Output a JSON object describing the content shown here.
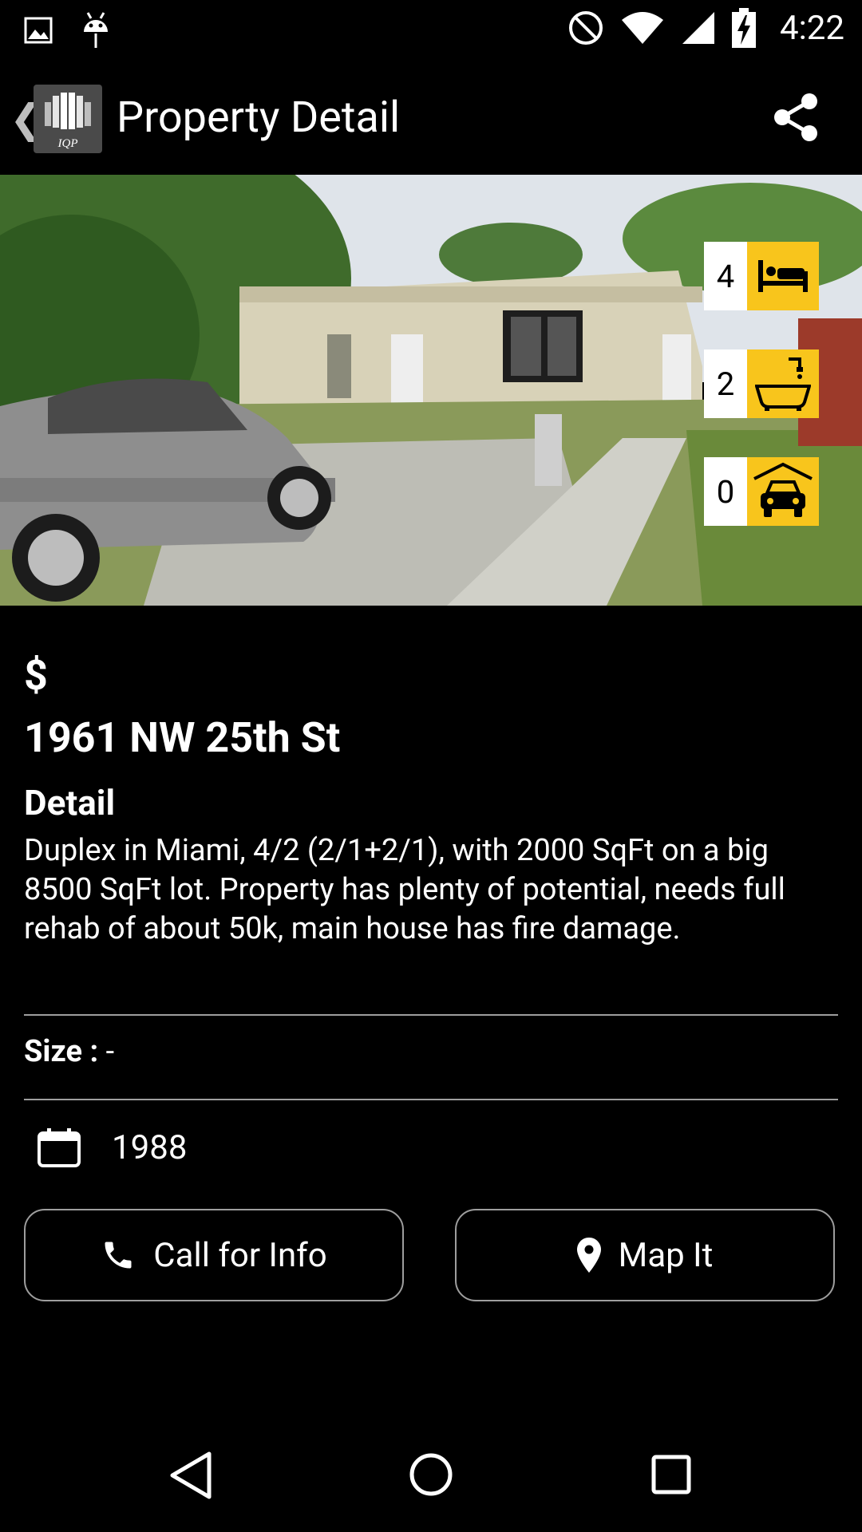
{
  "status_bar": {
    "time": "4:22",
    "icons": [
      "gallery-icon",
      "android-icon",
      "do-not-disturb-icon",
      "wifi-icon",
      "signal-icon",
      "battery-charging-icon"
    ]
  },
  "app_bar": {
    "title": "Property Detail",
    "logo_text": "IQP",
    "icons": [
      "back-chevron-icon",
      "share-icon"
    ]
  },
  "property": {
    "bedrooms": "4",
    "bathrooms": "2",
    "garage": "0",
    "price": "$",
    "address": "1961 NW 25th St",
    "detail_heading": "Detail",
    "detail_text": "Duplex in Miami, 4/2 (2/1+2/1), with 2000 SqFt on a big 8500 SqFt lot. Property has plenty of potential, needs full rehab of about 50k, main house has fire damage.",
    "size_label": "Size :",
    "size_value": "-",
    "year": "1988"
  },
  "actions": {
    "call_label": "Call for Info",
    "map_label": "Map It"
  },
  "colors": {
    "background": "#000000",
    "accent": "#f8c51c",
    "divider": "#9e9e9e"
  }
}
